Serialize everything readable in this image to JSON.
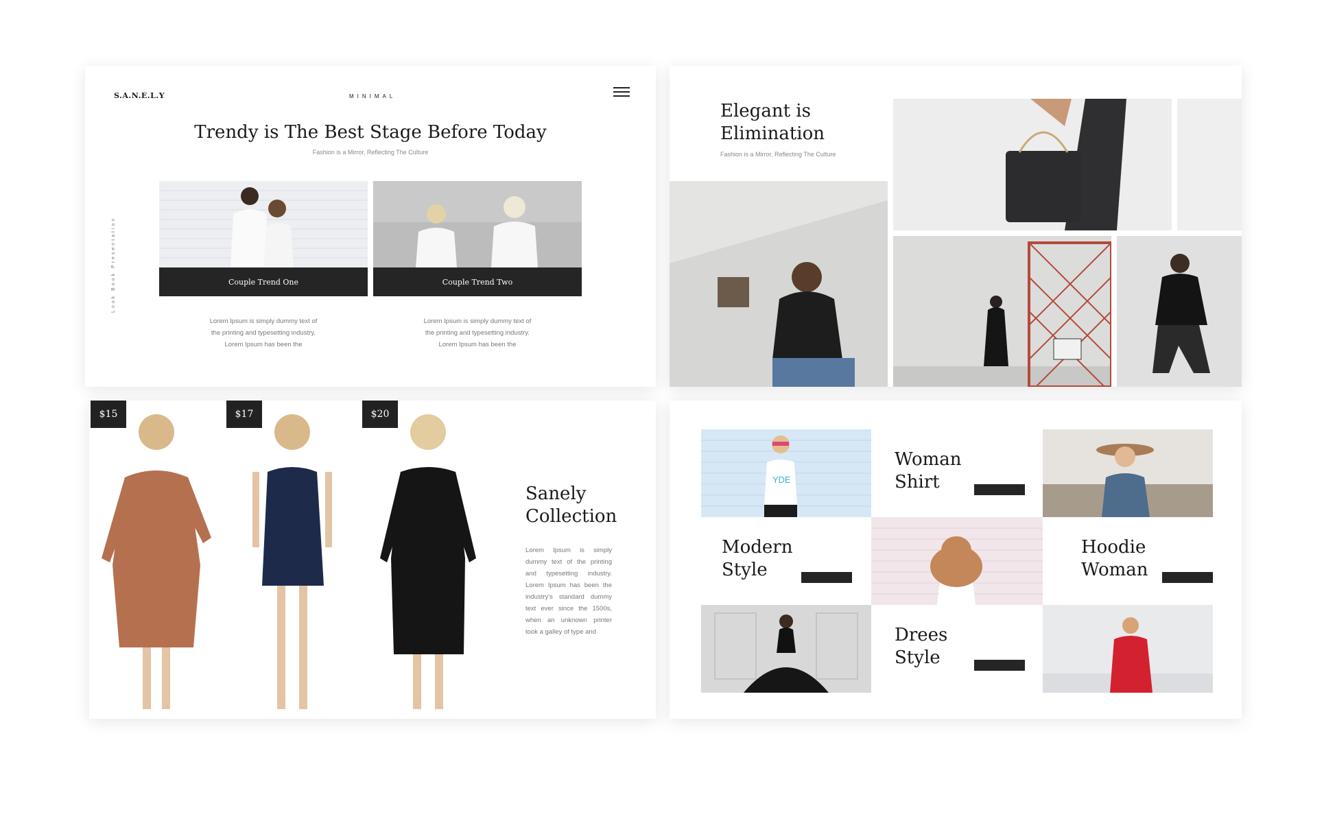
{
  "slide1": {
    "logo": "S.A.N.E.L.Y",
    "brand_tag": "MINIMAL",
    "title": "Trendy is The Best Stage Before Today",
    "subtitle": "Fashion is a Mirror, Reflecting The Culture",
    "vertical_label": "Look Book Presentation",
    "cards": [
      {
        "label": "Couple Trend One",
        "text": [
          "Lorem Ipsum is simply dummy text of",
          "the printing and typesetting industry.",
          "Lorem Ipsum has been the"
        ]
      },
      {
        "label": "Couple Trend Two",
        "text": [
          "Lorem Ipsum is simply dummy text of",
          "the printing and typesetting industry.",
          "Lorem Ipsum has been the"
        ]
      }
    ]
  },
  "slide2": {
    "title_line1": "Elegant is",
    "title_line2": "Elimination",
    "subtitle": "Fashion is a Mirror, Reflecting The Culture"
  },
  "slide3": {
    "prices": [
      "$15",
      "$17",
      "$20"
    ],
    "title_line1": "Sanely",
    "title_line2": "Collection",
    "text": "Lorem Ipsum is simply dummy text of the printing and typesetting industry. Lorem Ipsum has been the industry's standard dummy text ever since the 1500s, when an unknown printer took a galley of type and"
  },
  "slide4": {
    "tiles": [
      {
        "line1": "Woman",
        "line2": "Shirt"
      },
      {
        "line1": "Modern",
        "line2": "Style"
      },
      {
        "line1": "Hoodie",
        "line2": "Woman"
      },
      {
        "line1": "Drees",
        "line2": "Style"
      }
    ],
    "shirt_print": "YDE"
  },
  "colors": {
    "dark": "#252525",
    "text_gray": "#777777",
    "background": "#ffffff"
  }
}
